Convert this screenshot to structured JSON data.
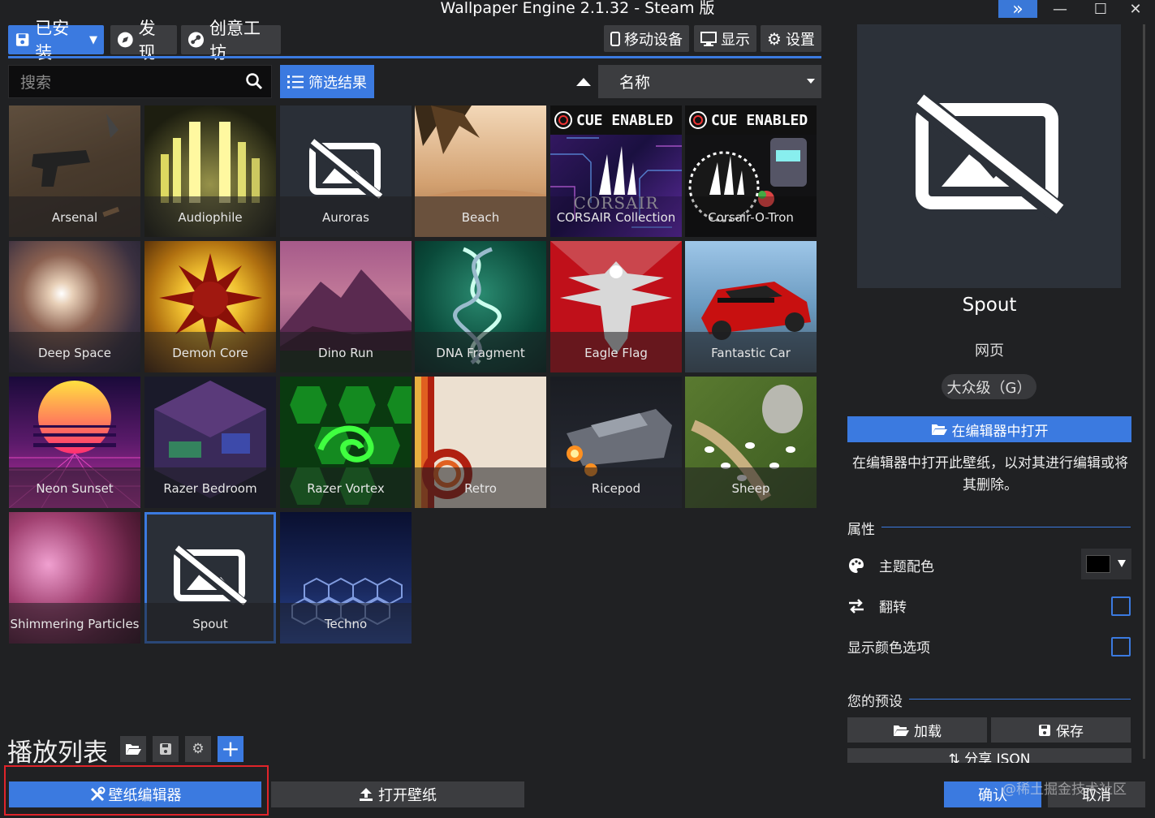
{
  "window": {
    "title": "Wallpaper Engine 2.1.32 - Steam 版",
    "expand_glyph": "»",
    "min_glyph": "—",
    "max_glyph": "☐",
    "close_glyph": "✕"
  },
  "nav": {
    "installed": "已安装",
    "discover": "发现",
    "workshop": "创意工坊"
  },
  "top": {
    "mobile": "移动设备",
    "display": "显示",
    "settings": "设置"
  },
  "search": {
    "placeholder": "搜索"
  },
  "filter_label": "筛选结果",
  "sort": {
    "selected": "名称"
  },
  "wallpapers": [
    {
      "name": "Arsenal"
    },
    {
      "name": "Audiophile"
    },
    {
      "name": "Auroras"
    },
    {
      "name": "Beach"
    },
    {
      "name": "CORSAIR Collection",
      "badge": "CUE ENABLED",
      "brand": "CORSAIR"
    },
    {
      "name": "Corsair-O-Tron",
      "badge": "CUE ENABLED"
    },
    {
      "name": "Deep Space"
    },
    {
      "name": "Demon Core"
    },
    {
      "name": "Dino Run"
    },
    {
      "name": "DNA Fragment"
    },
    {
      "name": "Eagle Flag"
    },
    {
      "name": "Fantastic Car"
    },
    {
      "name": "Neon Sunset"
    },
    {
      "name": "Razer Bedroom"
    },
    {
      "name": "Razer Vortex"
    },
    {
      "name": "Retro"
    },
    {
      "name": "Ricepod"
    },
    {
      "name": "Sheep"
    },
    {
      "name": "Shimmering Particles"
    },
    {
      "name": "Spout"
    },
    {
      "name": "Techno"
    }
  ],
  "playlist": {
    "title": "播放列表",
    "add": "+"
  },
  "bottom": {
    "editor": "壁纸编辑器",
    "open": "打开壁纸"
  },
  "details": {
    "name": "Spout",
    "type": "网页",
    "rating": "大众级（G）",
    "open_in_editor": "在编辑器中打开",
    "description": "在编辑器中打开此壁纸，以对其进行编辑或将其删除。",
    "properties_title": "属性",
    "theme_color": "主题配色",
    "flip": "翻转",
    "show_color_options": "显示颜色选项",
    "presets_title": "您的预设",
    "load": "加载",
    "save": "保存",
    "share": "分享 JSON",
    "confirm": "确认",
    "cancel": "取消"
  },
  "watermark": "@稀土掘金技术社区",
  "colors": {
    "accent": "#3b7ae0",
    "bg": "#202123",
    "button": "#3c3d40"
  }
}
